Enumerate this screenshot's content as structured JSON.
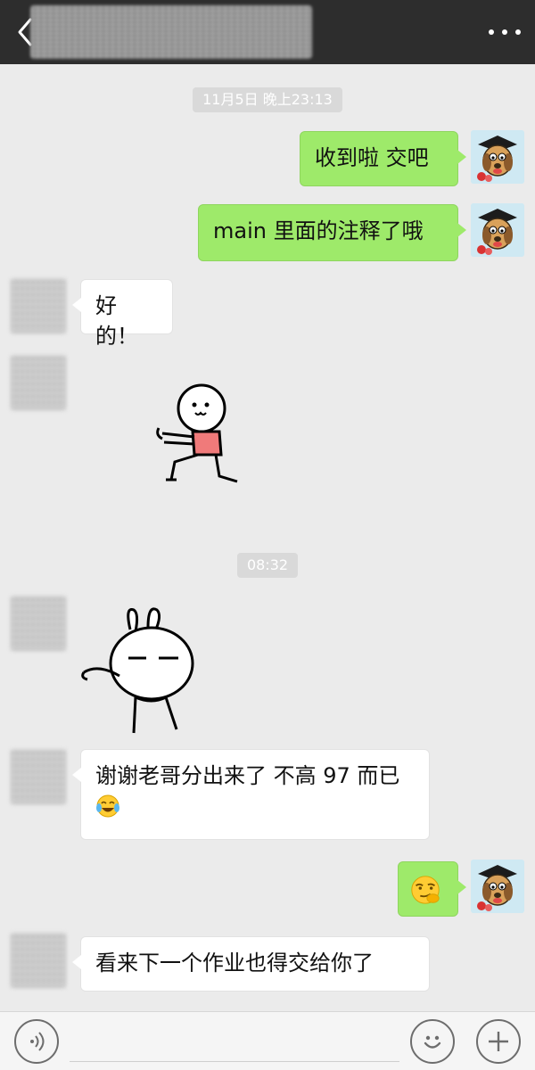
{
  "header": {
    "back_icon": "chevron-left-icon",
    "more_icon": "ellipsis-icon",
    "background": "#2d2d2d"
  },
  "timestamps": [
    "11月5日 晚上23:13",
    "08:32"
  ],
  "messages": [
    {
      "side": "right",
      "text": "收到啦 交吧"
    },
    {
      "side": "right",
      "text": "main 里面的注释了哦"
    },
    {
      "side": "left",
      "text": "好的！"
    },
    {
      "side": "left",
      "sticker": "running-stickman-sticker"
    },
    {
      "side": "left",
      "sticker": "bunny-waving-sticker"
    },
    {
      "side": "left",
      "text": "谢谢老哥分出来了 不高 97 而已",
      "emoji": "tears-of-joy-emoji"
    },
    {
      "side": "right",
      "emoji": "smirk-emoji"
    },
    {
      "side": "left",
      "text": "看来下一个作业也得交给你了"
    }
  ],
  "input_bar": {
    "voice_icon": "voice-icon",
    "emoji_icon": "smiley-icon",
    "plus_icon": "plus-icon"
  },
  "colors": {
    "bubble_right": "#9eea6a",
    "bubble_left": "#ffffff",
    "chat_background": "#ebebeb"
  }
}
